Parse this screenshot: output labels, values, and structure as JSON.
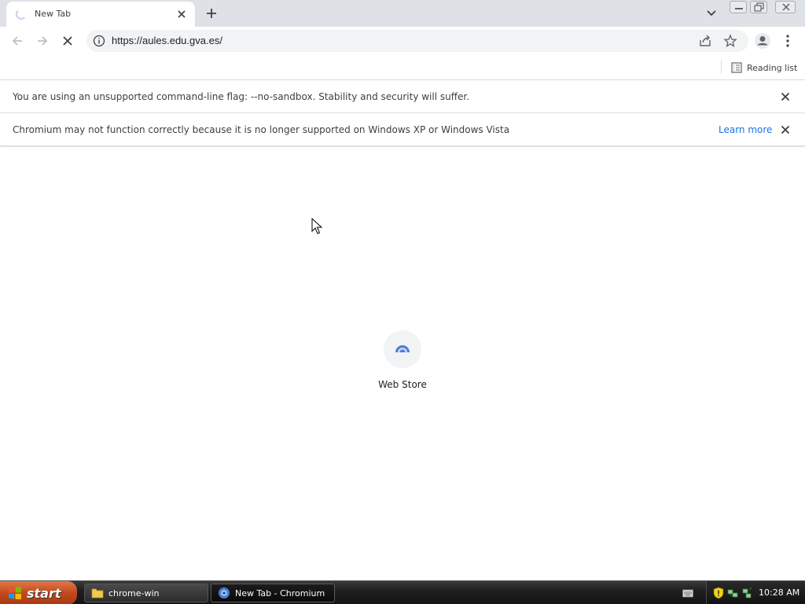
{
  "tab": {
    "title": "New Tab"
  },
  "toolbar": {
    "url": "https://aules.edu.gva.es/"
  },
  "bookmarks": {
    "reading_list_label": "Reading list"
  },
  "infobars": [
    {
      "text": "You are using an unsupported command-line flag: --no-sandbox. Stability and security will suffer.",
      "link": ""
    },
    {
      "text": "Chromium may not function correctly because it is no longer supported on Windows XP or Windows Vista",
      "link": "Learn more"
    }
  ],
  "content": {
    "shortcuts": [
      {
        "label": "Web Store",
        "icon": "web-store-icon"
      }
    ]
  },
  "taskbar": {
    "start_label": "start",
    "tasks": [
      {
        "label": "chrome-win",
        "icon": "folder-icon"
      },
      {
        "label": "New Tab - Chromium",
        "icon": "chromium-icon"
      }
    ],
    "clock": "10:28 AM"
  },
  "colors": {
    "tabstrip_bg": "#dee1e6",
    "link_blue": "#1a73e8",
    "omnibox_bg": "#f1f3f4"
  }
}
